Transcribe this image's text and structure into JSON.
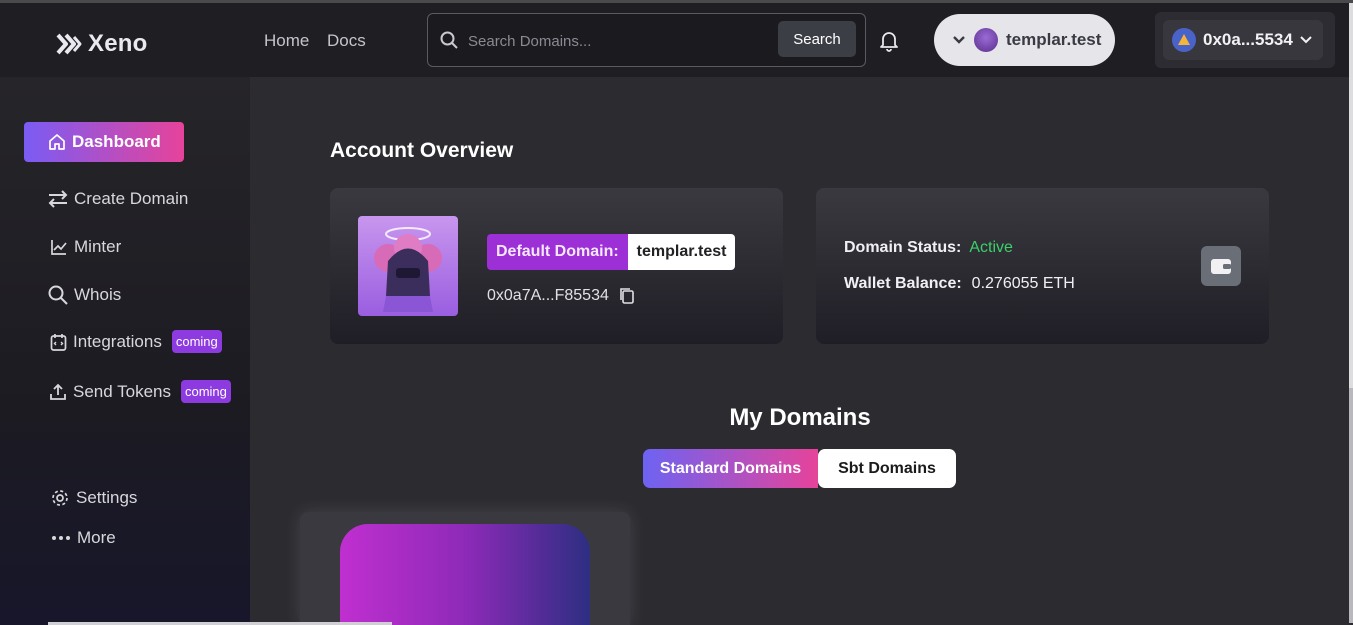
{
  "header": {
    "brand": "Xeno",
    "nav": [
      "Home",
      "Docs"
    ],
    "search_placeholder": "Search Domains...",
    "search_button": "Search",
    "domain_pill": "templar.test",
    "wallet_short": "0x0a...5534"
  },
  "sidebar": {
    "items": [
      {
        "label": "Dashboard",
        "icon": "home-icon",
        "active": true
      },
      {
        "label": "Create Domain",
        "icon": "swap-arrows-icon"
      },
      {
        "label": "Minter",
        "icon": "chart-icon"
      },
      {
        "label": "Whois",
        "icon": "search-icon"
      },
      {
        "label": "Integrations",
        "icon": "integrations-icon",
        "badge": "coming"
      },
      {
        "label": "Send Tokens",
        "icon": "upload-icon",
        "badge": "coming"
      }
    ],
    "footer": [
      {
        "label": "Settings",
        "icon": "gear-icon"
      },
      {
        "label": "More",
        "icon": "more-dots-icon"
      }
    ]
  },
  "overview": {
    "title": "Account Overview",
    "default_domain_label": "Default Domain:",
    "default_domain_value": "templar.test",
    "address": "0x0a7A...F85534",
    "domain_status_label": "Domain Status:",
    "domain_status_value": "Active",
    "wallet_balance_label": "Wallet Balance:",
    "wallet_balance_value": "0.276055 ETH"
  },
  "my_domains": {
    "title": "My Domains",
    "tabs": [
      "Standard Domains",
      "Sbt Domains"
    ],
    "active_tab": "Standard Domains"
  },
  "colors": {
    "accent_gradient_start": "#7a5cf4",
    "accent_gradient_end": "#e6439a",
    "status_active": "#3ccf6a",
    "badge": "#8d3ae0"
  }
}
